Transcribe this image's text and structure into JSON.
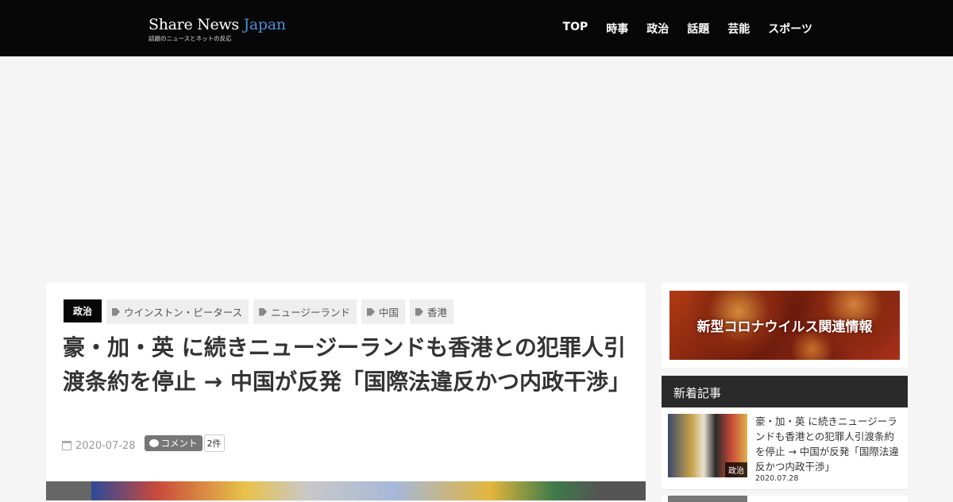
{
  "header": {
    "logo": {
      "title_main": "Share News ",
      "title_accent": "Japan",
      "subtitle": "話題のニュースとネットの反応"
    },
    "nav": [
      "TOP",
      "時事",
      "政治",
      "話題",
      "芸能",
      "スポーツ"
    ]
  },
  "article": {
    "category": "政治",
    "tags": [
      "ウインストン・ピータース",
      "ニュージーランド",
      "中国",
      "香港"
    ],
    "title": "豪・加・英 に続きニュージーランドも香港との犯罪人引渡条約を停止 → 中国が反発「国際法違反かつ内政干渉」",
    "date": "2020-07-28",
    "comment_label": "コメント",
    "comment_count": "2件"
  },
  "sidebar": {
    "banner_text": "新型コロナウイルス関連情報",
    "section_title": "新着記事",
    "items": [
      {
        "title": "豪・加・英 に続きニュージーランドも香港との犯罪人引渡条約を停止 → 中国が反発「国際法違反かつ内政干渉」",
        "category": "政治",
        "date": "2020.07.28"
      }
    ]
  }
}
